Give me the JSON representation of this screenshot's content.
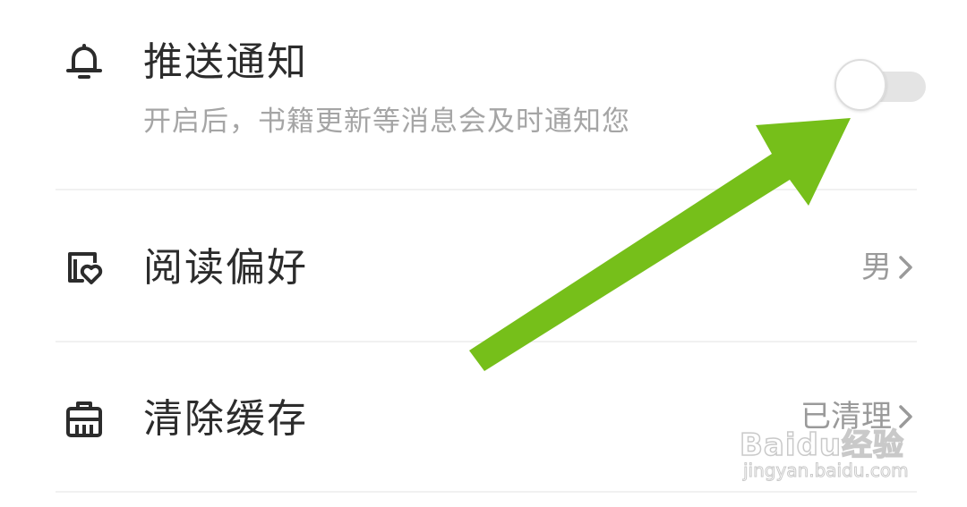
{
  "settings": {
    "push": {
      "title": "推送通知",
      "description": "开启后，书籍更新等消息会及时通知您",
      "icon": "bell-icon",
      "enabled": false
    },
    "reading_preference": {
      "title": "阅读偏好",
      "value": "男",
      "icon": "book-heart-icon"
    },
    "clear_cache": {
      "title": "清除缓存",
      "value": "已清理",
      "icon": "broom-icon"
    }
  },
  "watermark": {
    "brand": "Baidu经验",
    "url": "jingyan.baidu.com"
  },
  "colors": {
    "arrow": "#76bf1a",
    "toggle_track": "#e4e4e4",
    "subtitle": "#a5a5a5",
    "value": "#9a9a9a"
  }
}
